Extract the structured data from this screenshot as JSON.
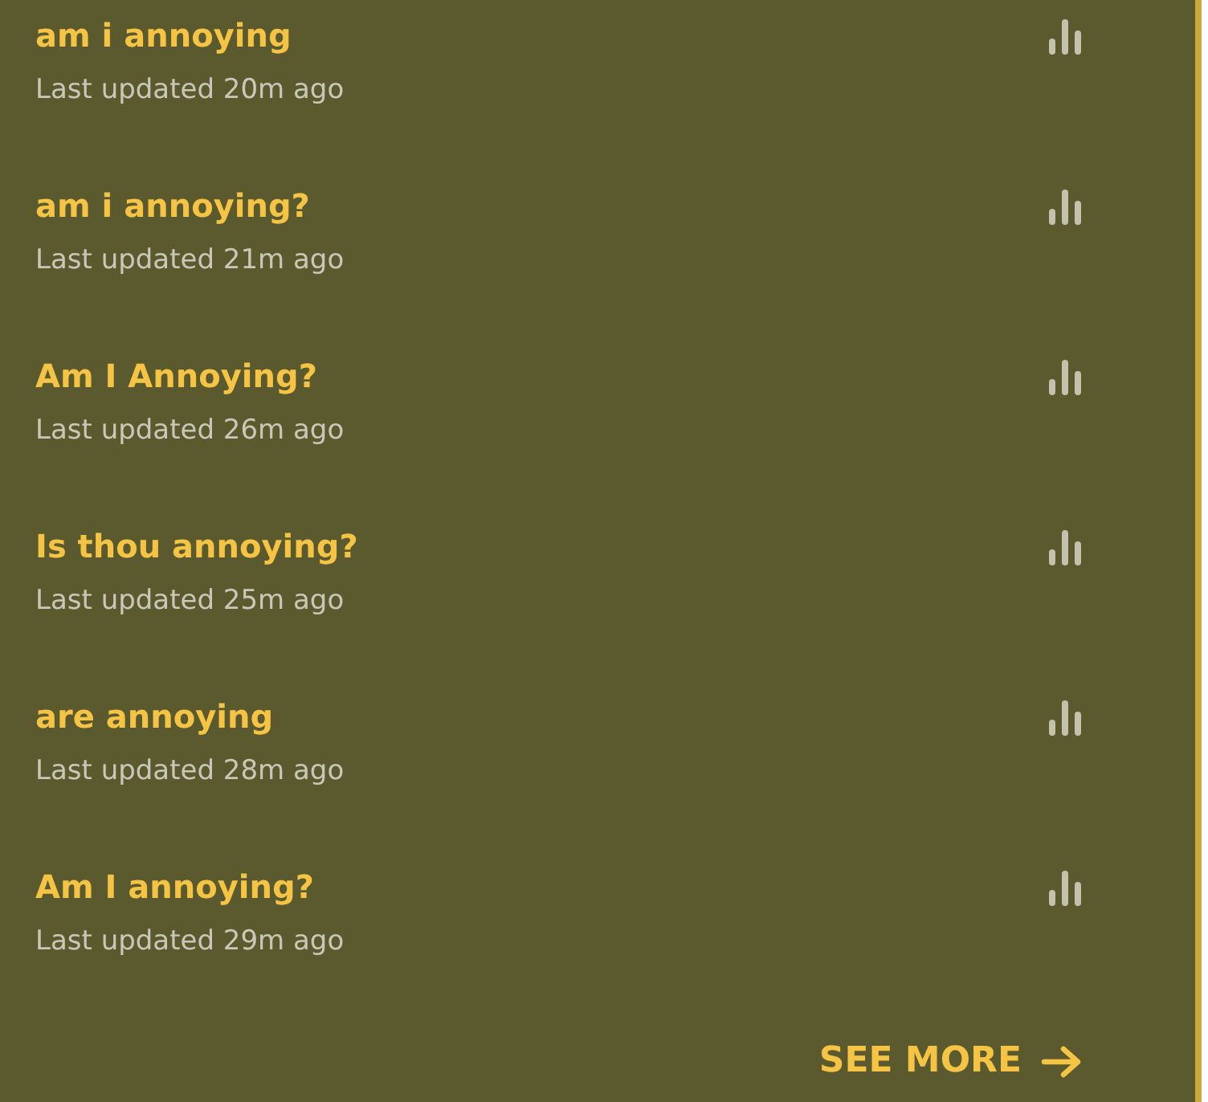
{
  "items": [
    {
      "title": "am i annoying",
      "updated": "Last updated 20m ago"
    },
    {
      "title": "am i annoying?",
      "updated": "Last updated 21m ago"
    },
    {
      "title": "Am I Annoying?",
      "updated": "Last updated 26m ago"
    },
    {
      "title": "Is thou annoying?",
      "updated": "Last updated 25m ago"
    },
    {
      "title": "are annoying",
      "updated": "Last updated 28m ago"
    },
    {
      "title": "Am I annoying?",
      "updated": "Last updated 29m ago"
    }
  ],
  "see_more": "SEE MORE"
}
